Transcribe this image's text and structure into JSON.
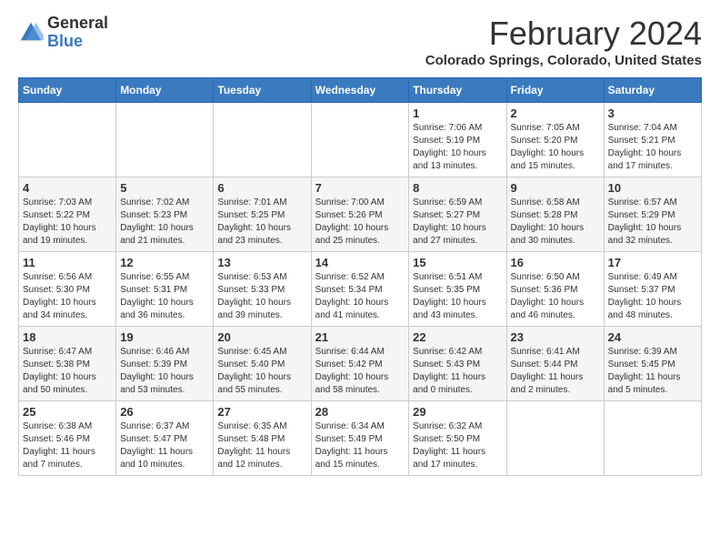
{
  "header": {
    "logo_general": "General",
    "logo_blue": "Blue",
    "month_title": "February 2024",
    "location": "Colorado Springs, Colorado, United States"
  },
  "days_of_week": [
    "Sunday",
    "Monday",
    "Tuesday",
    "Wednesday",
    "Thursday",
    "Friday",
    "Saturday"
  ],
  "weeks": [
    [
      {
        "day": "",
        "info": ""
      },
      {
        "day": "",
        "info": ""
      },
      {
        "day": "",
        "info": ""
      },
      {
        "day": "",
        "info": ""
      },
      {
        "day": "1",
        "info": "Sunrise: 7:06 AM\nSunset: 5:19 PM\nDaylight: 10 hours\nand 13 minutes."
      },
      {
        "day": "2",
        "info": "Sunrise: 7:05 AM\nSunset: 5:20 PM\nDaylight: 10 hours\nand 15 minutes."
      },
      {
        "day": "3",
        "info": "Sunrise: 7:04 AM\nSunset: 5:21 PM\nDaylight: 10 hours\nand 17 minutes."
      }
    ],
    [
      {
        "day": "4",
        "info": "Sunrise: 7:03 AM\nSunset: 5:22 PM\nDaylight: 10 hours\nand 19 minutes."
      },
      {
        "day": "5",
        "info": "Sunrise: 7:02 AM\nSunset: 5:23 PM\nDaylight: 10 hours\nand 21 minutes."
      },
      {
        "day": "6",
        "info": "Sunrise: 7:01 AM\nSunset: 5:25 PM\nDaylight: 10 hours\nand 23 minutes."
      },
      {
        "day": "7",
        "info": "Sunrise: 7:00 AM\nSunset: 5:26 PM\nDaylight: 10 hours\nand 25 minutes."
      },
      {
        "day": "8",
        "info": "Sunrise: 6:59 AM\nSunset: 5:27 PM\nDaylight: 10 hours\nand 27 minutes."
      },
      {
        "day": "9",
        "info": "Sunrise: 6:58 AM\nSunset: 5:28 PM\nDaylight: 10 hours\nand 30 minutes."
      },
      {
        "day": "10",
        "info": "Sunrise: 6:57 AM\nSunset: 5:29 PM\nDaylight: 10 hours\nand 32 minutes."
      }
    ],
    [
      {
        "day": "11",
        "info": "Sunrise: 6:56 AM\nSunset: 5:30 PM\nDaylight: 10 hours\nand 34 minutes."
      },
      {
        "day": "12",
        "info": "Sunrise: 6:55 AM\nSunset: 5:31 PM\nDaylight: 10 hours\nand 36 minutes."
      },
      {
        "day": "13",
        "info": "Sunrise: 6:53 AM\nSunset: 5:33 PM\nDaylight: 10 hours\nand 39 minutes."
      },
      {
        "day": "14",
        "info": "Sunrise: 6:52 AM\nSunset: 5:34 PM\nDaylight: 10 hours\nand 41 minutes."
      },
      {
        "day": "15",
        "info": "Sunrise: 6:51 AM\nSunset: 5:35 PM\nDaylight: 10 hours\nand 43 minutes."
      },
      {
        "day": "16",
        "info": "Sunrise: 6:50 AM\nSunset: 5:36 PM\nDaylight: 10 hours\nand 46 minutes."
      },
      {
        "day": "17",
        "info": "Sunrise: 6:49 AM\nSunset: 5:37 PM\nDaylight: 10 hours\nand 48 minutes."
      }
    ],
    [
      {
        "day": "18",
        "info": "Sunrise: 6:47 AM\nSunset: 5:38 PM\nDaylight: 10 hours\nand 50 minutes."
      },
      {
        "day": "19",
        "info": "Sunrise: 6:46 AM\nSunset: 5:39 PM\nDaylight: 10 hours\nand 53 minutes."
      },
      {
        "day": "20",
        "info": "Sunrise: 6:45 AM\nSunset: 5:40 PM\nDaylight: 10 hours\nand 55 minutes."
      },
      {
        "day": "21",
        "info": "Sunrise: 6:44 AM\nSunset: 5:42 PM\nDaylight: 10 hours\nand 58 minutes."
      },
      {
        "day": "22",
        "info": "Sunrise: 6:42 AM\nSunset: 5:43 PM\nDaylight: 11 hours\nand 0 minutes."
      },
      {
        "day": "23",
        "info": "Sunrise: 6:41 AM\nSunset: 5:44 PM\nDaylight: 11 hours\nand 2 minutes."
      },
      {
        "day": "24",
        "info": "Sunrise: 6:39 AM\nSunset: 5:45 PM\nDaylight: 11 hours\nand 5 minutes."
      }
    ],
    [
      {
        "day": "25",
        "info": "Sunrise: 6:38 AM\nSunset: 5:46 PM\nDaylight: 11 hours\nand 7 minutes."
      },
      {
        "day": "26",
        "info": "Sunrise: 6:37 AM\nSunset: 5:47 PM\nDaylight: 11 hours\nand 10 minutes."
      },
      {
        "day": "27",
        "info": "Sunrise: 6:35 AM\nSunset: 5:48 PM\nDaylight: 11 hours\nand 12 minutes."
      },
      {
        "day": "28",
        "info": "Sunrise: 6:34 AM\nSunset: 5:49 PM\nDaylight: 11 hours\nand 15 minutes."
      },
      {
        "day": "29",
        "info": "Sunrise: 6:32 AM\nSunset: 5:50 PM\nDaylight: 11 hours\nand 17 minutes."
      },
      {
        "day": "",
        "info": ""
      },
      {
        "day": "",
        "info": ""
      }
    ]
  ]
}
